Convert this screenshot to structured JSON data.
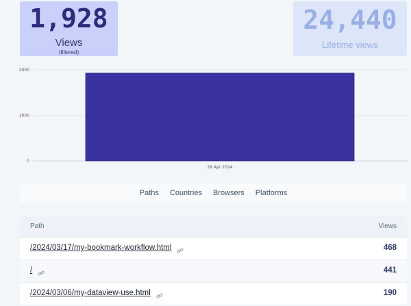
{
  "stats": {
    "views": {
      "number": "1,928",
      "label": "Views",
      "sub": "(filtered)"
    },
    "lifetime": {
      "number": "24,440",
      "label": "Lifetime views"
    }
  },
  "chart_data": {
    "type": "bar",
    "categories": [
      "29 Apr 2024"
    ],
    "values": [
      1928
    ],
    "ylim": [
      0,
      2000
    ],
    "yticks": [
      0,
      1000,
      2000
    ],
    "grid": true,
    "bar_color": "#3a32a0"
  },
  "tabs": [
    {
      "label": "Paths"
    },
    {
      "label": "Countries"
    },
    {
      "label": "Browsers"
    },
    {
      "label": "Platforms"
    }
  ],
  "table": {
    "headers": {
      "path": "Path",
      "views": "Views"
    },
    "rows": [
      {
        "path": "/2024/03/17/my-bookmark-workflow.html",
        "views": "468"
      },
      {
        "path": "/",
        "views": "441"
      },
      {
        "path": "/2024/03/06/my-dataview-use.html",
        "views": "190"
      }
    ]
  },
  "icons": {
    "row_link": "link-icon"
  }
}
